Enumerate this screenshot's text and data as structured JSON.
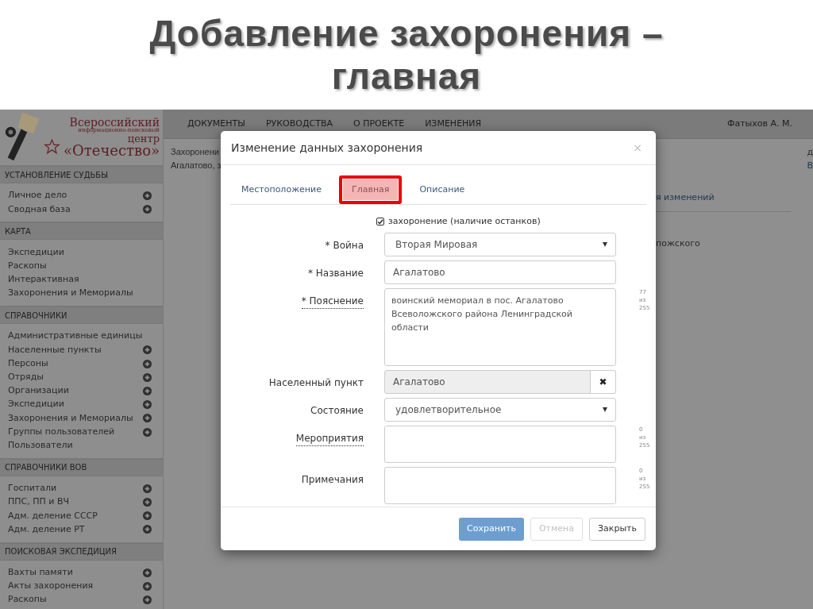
{
  "slide": {
    "title_lines": [
      "Добавление захоронения –",
      "главная"
    ]
  },
  "logo": {
    "lines": [
      "Всероссийский",
      "информационно-поисковый",
      "центр",
      "«Отечество»"
    ]
  },
  "nav": {
    "items": [
      "ДОКУМЕНТЫ",
      "РУКОВОДСТВА",
      "О ПРОЕКТЕ",
      "ИЗМЕНЕНИЯ"
    ],
    "user": "Фатыхов А. М."
  },
  "sidebar": [
    {
      "title": "УСТАНОВЛЕНИЕ СУДЬБЫ",
      "items": [
        {
          "label": "Личное дело",
          "add": true
        },
        {
          "label": "Сводная база",
          "add": true
        }
      ]
    },
    {
      "title": "КАРТА",
      "items": [
        {
          "label": "Экспедиции",
          "add": false
        },
        {
          "label": "Раскопы",
          "add": false
        },
        {
          "label": "Интерактивная",
          "add": false
        },
        {
          "label": "Захоронения и Мемориалы",
          "add": false
        }
      ]
    },
    {
      "title": "СПРАВОЧНИКИ",
      "items": [
        {
          "label": "Административные единицы",
          "add": false
        },
        {
          "label": "Населенные пункты",
          "add": true
        },
        {
          "label": "Персоны",
          "add": true
        },
        {
          "label": "Отряды",
          "add": true
        },
        {
          "label": "Организации",
          "add": true
        },
        {
          "label": "Экспедиции",
          "add": true
        },
        {
          "label": "Захоронения и Мемориалы",
          "add": true
        },
        {
          "label": "Группы пользователей",
          "add": true
        },
        {
          "label": "Пользователи",
          "add": false
        }
      ]
    },
    {
      "title": "СПРАВОЧНИКИ ВОВ",
      "items": [
        {
          "label": "Госпитали",
          "add": true
        },
        {
          "label": "ППС, ПП и ВЧ",
          "add": true
        },
        {
          "label": "Адм. деление СССР",
          "add": true
        },
        {
          "label": "Адм. деление РТ",
          "add": true
        }
      ]
    },
    {
      "title": "ПОИСКОВАЯ ЭКСПЕДИЦИЯ",
      "items": [
        {
          "label": "Вахты памяти",
          "add": true
        },
        {
          "label": "Акты захоронения",
          "add": true
        },
        {
          "label": "Раскопы",
          "add": true
        }
      ]
    }
  ],
  "background": {
    "heading_lines": [
      "Захоронени",
      "Агалатово, з"
    ],
    "tab_text": "я изменений",
    "row_text": "пожского",
    "right_lines": [
      "д",
      "В"
    ]
  },
  "modal": {
    "title": "Изменение данных захоронения",
    "close": "×",
    "tabs": [
      {
        "label": "Местоположение",
        "selected": false
      },
      {
        "label": "Главная",
        "selected": true
      },
      {
        "label": "Описание",
        "selected": false
      }
    ],
    "checkbox": {
      "label": "захоронение (наличие останков)",
      "checked": true
    },
    "fields": [
      {
        "kind": "select",
        "label": "* Война",
        "hint": false,
        "value": "Вторая Мировая"
      },
      {
        "kind": "text",
        "label": "* Название",
        "hint": false,
        "value": "Агалатово"
      },
      {
        "kind": "textarea",
        "label": "* Пояснение",
        "hint": true,
        "value": "воинский мемориал в пос. Агалатово Всеволожского района Ленинградской области",
        "counter": [
          "77",
          "из",
          "255"
        ],
        "tall": true
      },
      {
        "kind": "lookup",
        "label": "Населенный пункт",
        "hint": false,
        "value": "Агалатово",
        "clear": "✖"
      },
      {
        "kind": "select",
        "label": "Состояние",
        "hint": false,
        "value": "удовлетворительное"
      },
      {
        "kind": "textarea",
        "label": "Мероприятия",
        "hint": true,
        "counter": [
          "0",
          "из",
          "255"
        ],
        "tall": false
      },
      {
        "kind": "textarea",
        "label": "Примечания",
        "hint": false,
        "counter": [
          "0",
          "из",
          "255"
        ],
        "tall": false
      }
    ],
    "buttons": [
      {
        "label": "Сохранить",
        "kind": "primary",
        "disabled": false
      },
      {
        "label": "Отмена",
        "kind": "default",
        "disabled": true
      },
      {
        "label": "Закрыть",
        "kind": "default",
        "disabled": false
      }
    ]
  }
}
